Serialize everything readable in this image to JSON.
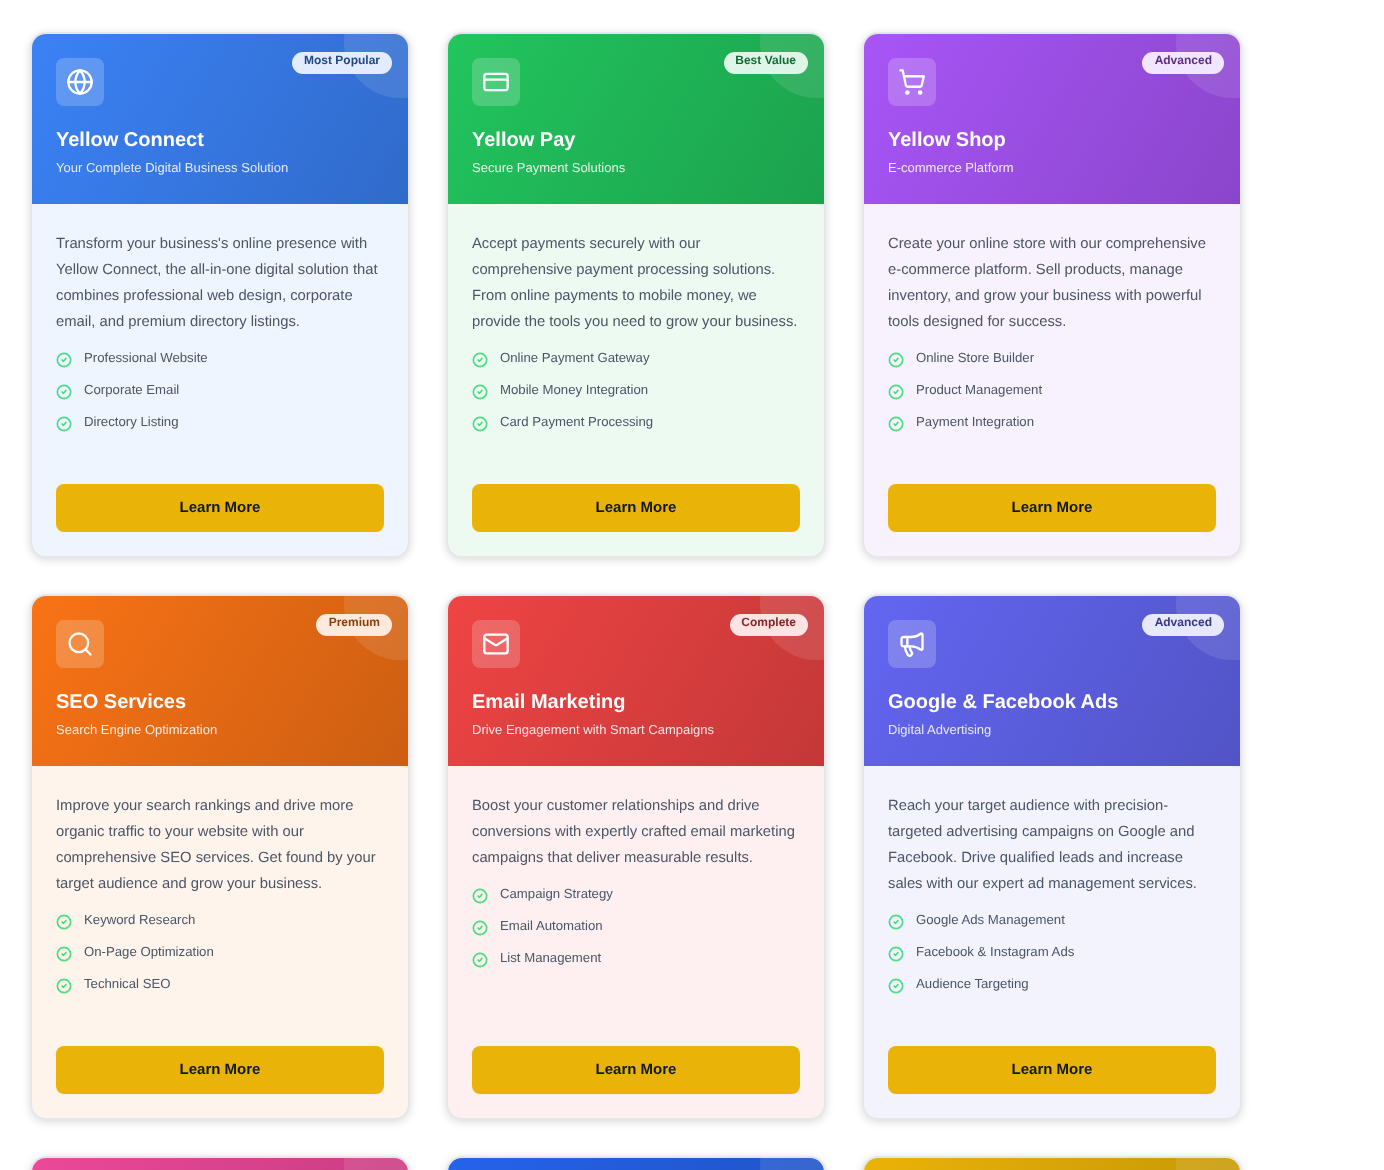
{
  "cards": [
    {
      "color": "#3b82f6",
      "badge": "Most Popular",
      "title": "Yellow Connect",
      "subtitle": "Your Complete Digital Business Solution",
      "description": "Transform your business's online presence with Yellow Connect, the all-in-one digital solution that combines professional web design, corporate email, and premium directory listings.",
      "features": [
        "Professional Website",
        "Corporate Email",
        "Directory Listing"
      ],
      "button": "Learn More"
    },
    {
      "color": "#22c55e",
      "badge": "Best Value",
      "title": "Yellow Pay",
      "subtitle": "Secure Payment Solutions",
      "description": "Accept payments securely with our comprehensive payment processing solutions. From online payments to mobile money, we provide the tools you need to grow your business.",
      "features": [
        "Online Payment Gateway",
        "Mobile Money Integration",
        "Card Payment Processing"
      ],
      "button": "Learn More"
    },
    {
      "color": "#a855f7",
      "badge": "Advanced",
      "title": "Yellow Shop",
      "subtitle": "E-commerce Platform",
      "description": "Create your online store with our comprehensive e-commerce platform. Sell products, manage inventory, and grow your business with powerful tools designed for success.",
      "features": [
        "Online Store Builder",
        "Product Management",
        "Payment Integration"
      ],
      "button": "Learn More"
    },
    {
      "color": "#f97316",
      "badge": "Premium",
      "title": "SEO Services",
      "subtitle": "Search Engine Optimization",
      "description": "Improve your search rankings and drive more organic traffic to your website with our comprehensive SEO services. Get found by your target audience and grow your business.",
      "features": [
        "Keyword Research",
        "On-Page Optimization",
        "Technical SEO"
      ],
      "button": "Learn More"
    },
    {
      "color": "#ef4444",
      "badge": "Complete",
      "title": "Email Marketing",
      "subtitle": "Drive Engagement with Smart Campaigns",
      "description": "Boost your customer relationships and drive conversions with expertly crafted email marketing campaigns that deliver measurable results.",
      "features": [
        "Campaign Strategy",
        "Email Automation",
        "List Management"
      ],
      "button": "Learn More"
    },
    {
      "color": "#6366f1",
      "badge": "Advanced",
      "title": "Google & Facebook Ads",
      "subtitle": "Digital Advertising",
      "description": "Reach your target audience with precision-targeted advertising campaigns on Google and Facebook. Drive qualified leads and increase sales with our expert ad management services.",
      "features": [
        "Google Ads Management",
        "Facebook & Instagram Ads",
        "Audience Targeting"
      ],
      "button": "Learn More"
    },
    {
      "color": "#ec4899"
    },
    {
      "color": "#2563eb"
    },
    {
      "color": "#eab308"
    }
  ]
}
